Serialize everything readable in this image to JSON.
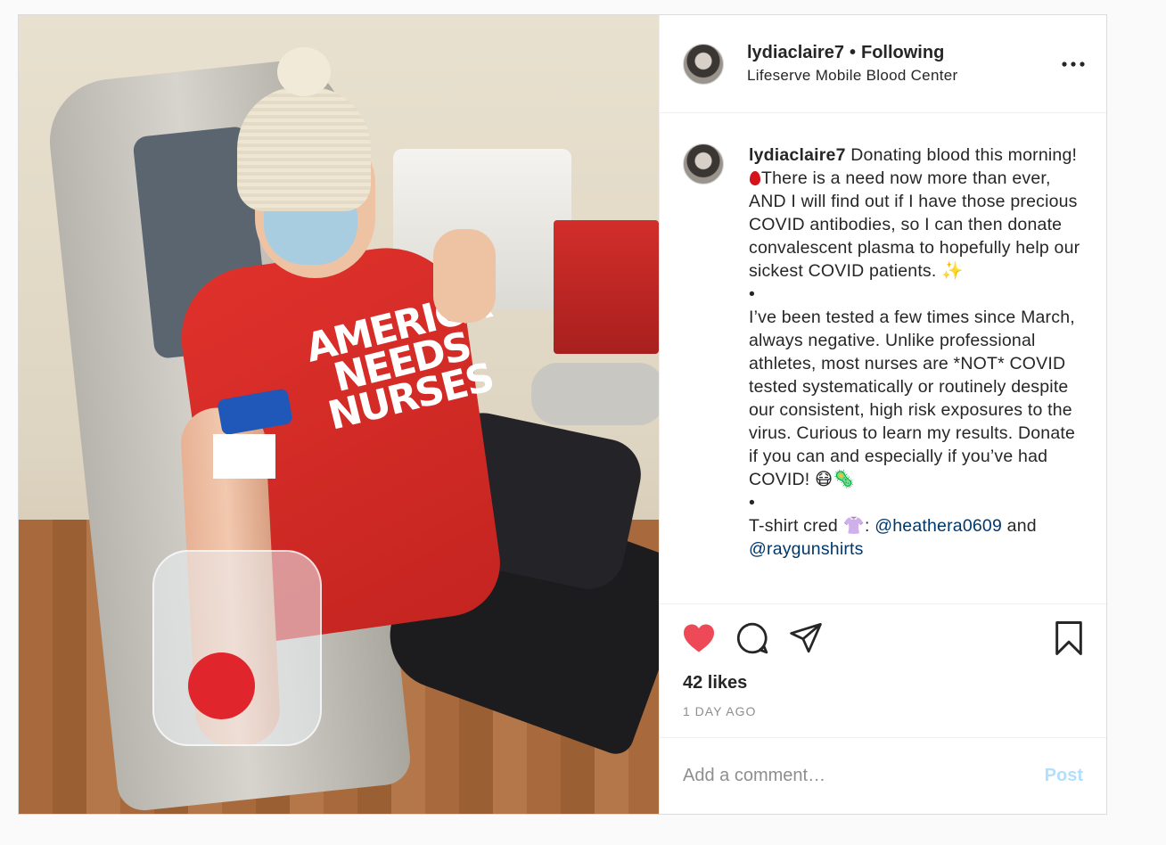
{
  "post": {
    "username": "lydiaclaire7",
    "separator": "•",
    "follow_status": "Following",
    "location": "Lifeserve Mobile Blood Center",
    "more_label": "•••",
    "photo_shirt_text": "AMERICA NEEDS NURSES",
    "caption": {
      "username": "lydiaclaire7",
      "text_1": " Donating blood this morning!",
      "text_2": "There is a need now more than ever, AND I will find out if I have those precious COVID antibodies, so I can then donate convalescent plasma to hopefully help our sickest COVID patients. ✨\n•\nI’ve been tested a few times since March, always negative. Unlike professional athletes, most nurses are *NOT* COVID tested systematically or routinely despite our consistent, high risk exposures to the virus. Curious to learn my results. Donate if you can and especially if you’ve had COVID! 😷🦠\n•\nT-shirt cred 👚: ",
      "mention_1": "@heathera0609",
      "text_3": " and ",
      "mention_2": "@raygunshirts"
    },
    "likes": "42 likes",
    "time": "1 DAY AGO",
    "comment_placeholder": "Add a comment…",
    "post_label": "Post"
  },
  "icons": {
    "like": "heart-icon",
    "comment": "comment-icon",
    "share": "paper-plane-icon",
    "save": "bookmark-icon",
    "more": "more-horizontal-icon"
  },
  "colors": {
    "like_red": "#ed4956",
    "mention_blue": "#00376b",
    "post_button_disabled": "#b2dffc",
    "muted_text": "#8e8e8e"
  }
}
